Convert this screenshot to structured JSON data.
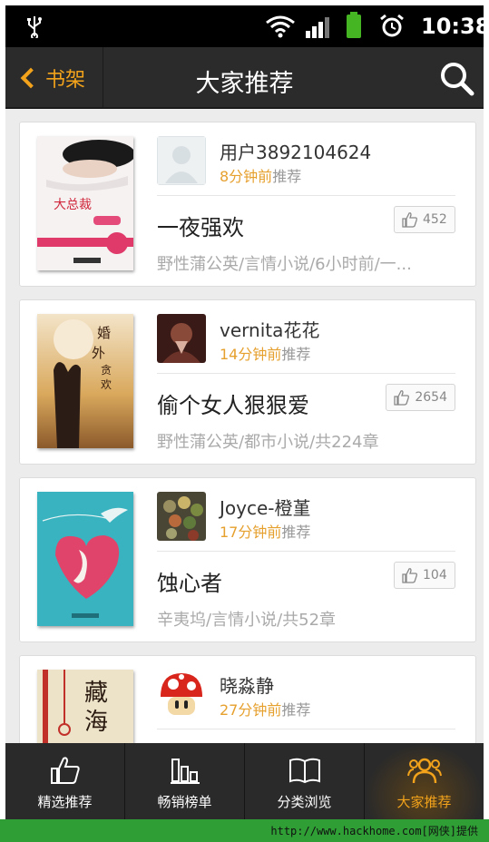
{
  "status_bar": {
    "time": "10:38"
  },
  "header": {
    "back_label": "书架",
    "title": "大家推荐"
  },
  "colors": {
    "accent": "#f2a31b",
    "minutes": "#e6a02e",
    "battery": "#46b523",
    "footer": "#2e9e35"
  },
  "recommendations": [
    {
      "user": "用户3892104624",
      "time": "8分钟前",
      "suffix": "推荐",
      "book_title": "一夜强欢",
      "likes": "452",
      "info": "野性蒲公英/言情小说/6小时前/一..."
    },
    {
      "user": "vernita花花",
      "time": "14分钟前",
      "suffix": "推荐",
      "book_title": "偷个女人狠狠爱",
      "likes": "2654",
      "info": "野性蒲公英/都市小说/共224章"
    },
    {
      "user": "Joyce-橙堇",
      "time": "17分钟前",
      "suffix": "推荐",
      "book_title": "蚀心者",
      "likes": "104",
      "info": "辛夷坞/言情小说/共52章"
    },
    {
      "user": "晓淼静",
      "time": "27分钟前",
      "suffix": "推荐",
      "book_title": "",
      "likes": "",
      "info": ""
    }
  ],
  "tabs": [
    {
      "label": "精选推荐",
      "icon": "thumbs-up-icon"
    },
    {
      "label": "畅销榜单",
      "icon": "bar-chart-icon"
    },
    {
      "label": "分类浏览",
      "icon": "open-book-icon"
    },
    {
      "label": "大家推荐",
      "icon": "people-icon"
    }
  ],
  "footer": {
    "credit": "http://www.hackhome.com[网侠]提供"
  }
}
